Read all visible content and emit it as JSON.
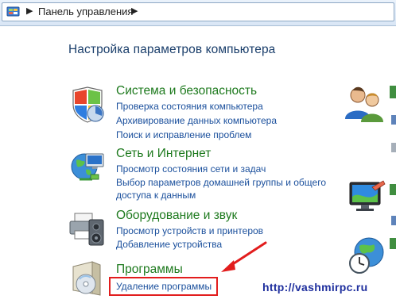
{
  "address_bar": {
    "crumb": "Панель управления",
    "sep_first": "▶",
    "sep_after": "▶"
  },
  "main": {
    "title": "Настройка параметров компьютера",
    "categories": [
      {
        "icon": "shield-icon",
        "title": "Система и безопасность",
        "links": [
          "Проверка состояния компьютера",
          "Архивирование данных компьютера",
          "Поиск и исправление проблем"
        ]
      },
      {
        "icon": "network-globe-icon",
        "title": "Сеть и Интернет",
        "links": [
          "Просмотр состояния сети и задач",
          "Выбор параметров домашней группы и общего",
          "доступа к данным"
        ]
      },
      {
        "icon": "printer-speaker-icon",
        "title": "Оборудование и звук",
        "links": [
          "Просмотр устройств и принтеров",
          "Добавление устройства"
        ]
      },
      {
        "icon": "programs-icon",
        "title": "Программы",
        "links": [
          "Удаление программы"
        ]
      }
    ]
  },
  "annotation": {
    "url": "http://vashmirpc.ru",
    "arrow_color": "#e21d1d",
    "highlight_color": "#e21d1d"
  },
  "colors": {
    "category_title": "#1e7a1e",
    "link": "#1a4f9c",
    "page_title": "#1a3e6b"
  }
}
